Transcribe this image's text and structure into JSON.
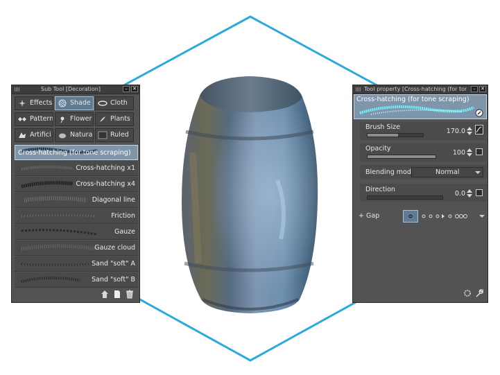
{
  "colors": {
    "hexagon": "#29a9dc",
    "panel": "#535353",
    "selection": "#7f95a9",
    "titlebar": "#3d3d3d"
  },
  "subtool": {
    "title": "Sub Tool [Decoration]",
    "tabs": [
      {
        "label": "Effects",
        "icon": "effects-icon"
      },
      {
        "label": "Shade",
        "icon": "shade-icon",
        "active": true
      },
      {
        "label": "Cloth",
        "icon": "cloth-icon"
      },
      {
        "label": "Pattern",
        "icon": "pattern-icon"
      },
      {
        "label": "Flower",
        "icon": "flower-icon"
      },
      {
        "label": "Plants",
        "icon": "plants-icon"
      },
      {
        "label": "Artifici",
        "icon": "artificial-icon"
      },
      {
        "label": "Natura",
        "icon": "nature-icon"
      },
      {
        "label": "Ruled",
        "icon": "ruled-icon"
      }
    ],
    "brushes": [
      {
        "label": "Cross-hatching (for tone scraping)",
        "selected": true
      },
      {
        "label": "Cross-hatching x1"
      },
      {
        "label": "Cross-hatching x4"
      },
      {
        "label": "Diagonal line"
      },
      {
        "label": "Friction"
      },
      {
        "label": "Gauze"
      },
      {
        "label": "Gauze cloud"
      },
      {
        "label": "Sand \"soft\" A"
      },
      {
        "label": "Sand \"soft\" B"
      }
    ],
    "footer_icons": [
      "sub-tool-settings-icon",
      "new-sub-tool-icon",
      "trash-icon"
    ]
  },
  "toolprop": {
    "title": "Tool property [Cross-hatching (for tone",
    "preview_label": "Cross-hatching (for tone scraping)",
    "brush_size": {
      "label": "Brush Size",
      "value": "170.0",
      "fraction": 0.55
    },
    "opacity": {
      "label": "Opacity",
      "value": "100",
      "fraction": 1.0
    },
    "blending": {
      "label": "Blending mode",
      "value": "Normal"
    },
    "direction": {
      "label": "Direction",
      "value": "0.0",
      "fraction": 0.0
    },
    "gap": {
      "label": "+ Gap"
    }
  }
}
